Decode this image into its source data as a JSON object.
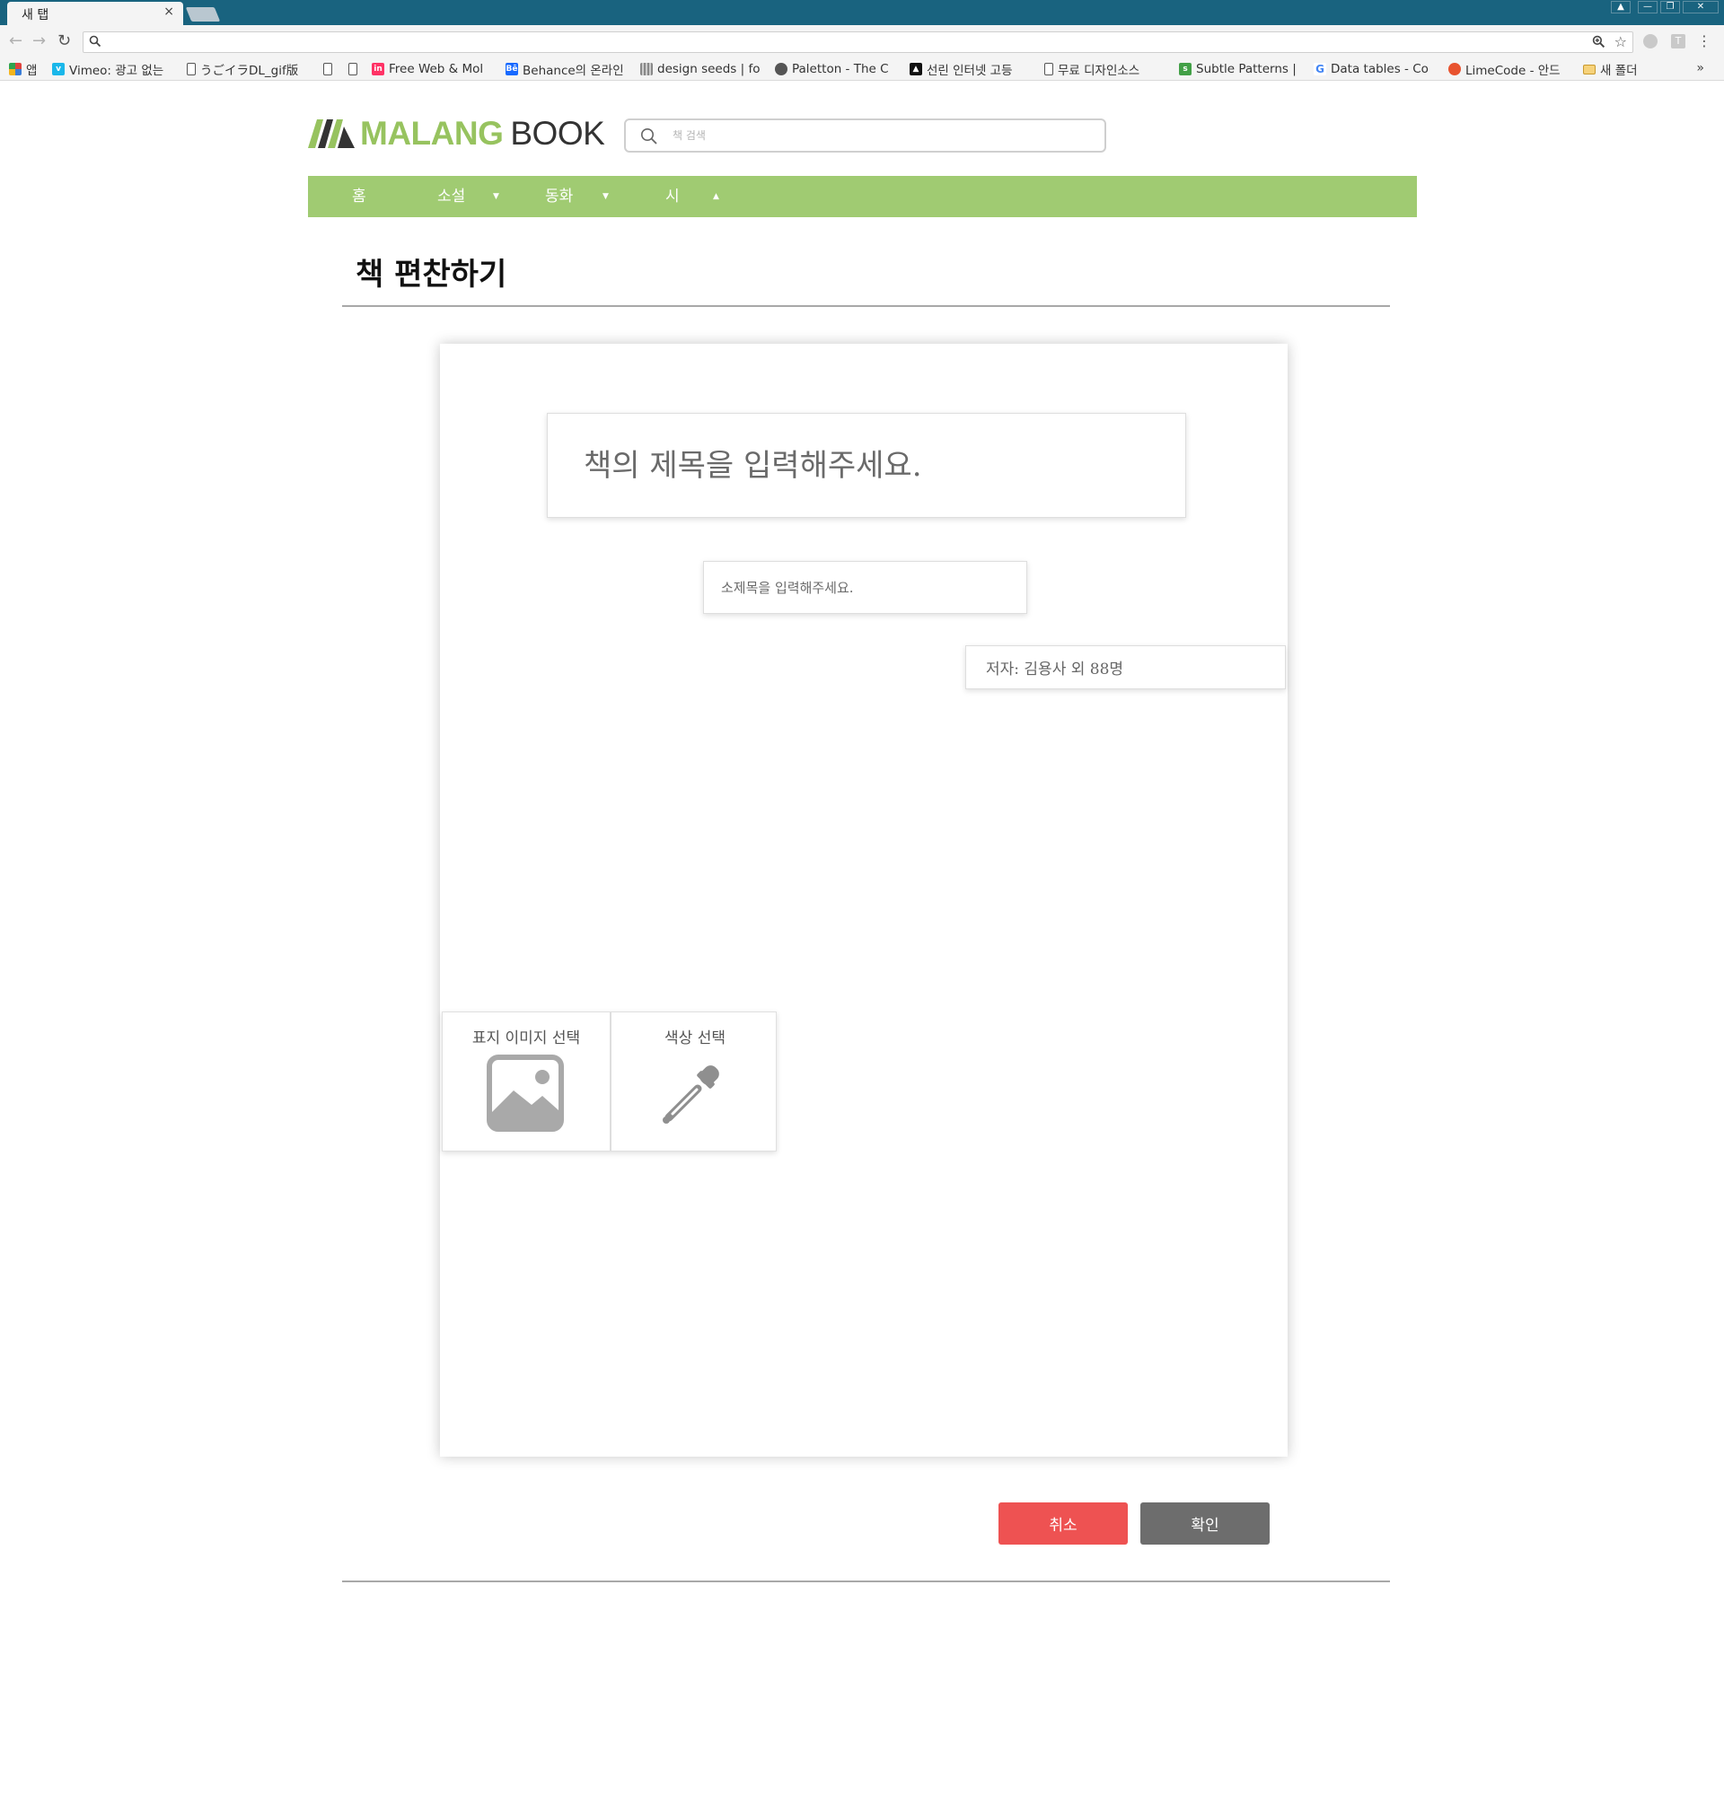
{
  "browser": {
    "tab_title": "새 탭",
    "tab_close": "×",
    "window_controls": [
      "▲",
      "—",
      "❐",
      "✕"
    ],
    "icons": [
      "back-icon",
      "forward-icon",
      "reload-icon",
      "search-icon",
      "zoom-icon",
      "star-icon",
      "extension-icon",
      "menu-icon"
    ],
    "bookmarks": [
      {
        "label": "앱",
        "icon": "apps-icon",
        "color": "#e0443e"
      },
      {
        "label": "Vimeo: 광고 없는",
        "icon": "vimeo-icon",
        "color": "#1ab7ea"
      },
      {
        "label": "うごイラDL_gif版",
        "icon": "page-icon",
        "color": ""
      },
      {
        "label": "",
        "icon": "page-icon",
        "color": ""
      },
      {
        "label": "",
        "icon": "page-icon",
        "color": ""
      },
      {
        "label": "Free Web & Mol",
        "icon": "invision-icon",
        "color": "#ff3366"
      },
      {
        "label": "Behance의 온라인",
        "icon": "behance-icon",
        "color": "#1769ff"
      },
      {
        "label": "design seeds | fo",
        "icon": "designseeds-icon",
        "color": "#888888"
      },
      {
        "label": "Paletton - The C",
        "icon": "paletton-icon",
        "color": "#555555"
      },
      {
        "label": "선린 인터넷 고등",
        "icon": "sunrin-icon",
        "color": "#111111"
      },
      {
        "label": "무료 디자인소스",
        "icon": "page-icon",
        "color": ""
      },
      {
        "label": "Subtle Patterns |",
        "icon": "subtlepatterns-icon",
        "color": "#43a047"
      },
      {
        "label": "Data tables - Co",
        "icon": "google-icon",
        "color": "#4285f4"
      },
      {
        "label": "LimeCode - 안드",
        "icon": "limecode-icon",
        "color": "#e8532f"
      },
      {
        "label": "새 폴더",
        "icon": "folder-icon",
        "color": "#e8b94b"
      }
    ],
    "bookmarks_more": "»"
  },
  "header": {
    "logo_malang": "MALANG",
    "logo_book": "BOOK",
    "search_placeholder": "책 검색"
  },
  "nav": {
    "items": [
      "홈",
      "소설",
      "동화",
      "시"
    ],
    "carets": [
      "▼",
      "▼",
      "▲"
    ]
  },
  "page": {
    "title": "책 편찬하기"
  },
  "form": {
    "title_placeholder": "책의 제목을 입력해주세요.",
    "subtitle_placeholder": "소제목을 입력해주세요.",
    "author_value": "저자: 김용사 외 88명",
    "cover_image_label": "표지 이미지 선택",
    "color_label": "색상 선택"
  },
  "actions": {
    "cancel": "취소",
    "confirm": "확인"
  },
  "colors": {
    "brand_green": "#a0cb72",
    "logo_green": "#97c35f",
    "cancel_red": "#ee5252",
    "confirm_gray": "#6d6d6d",
    "chrome_blue": "#19637f"
  }
}
